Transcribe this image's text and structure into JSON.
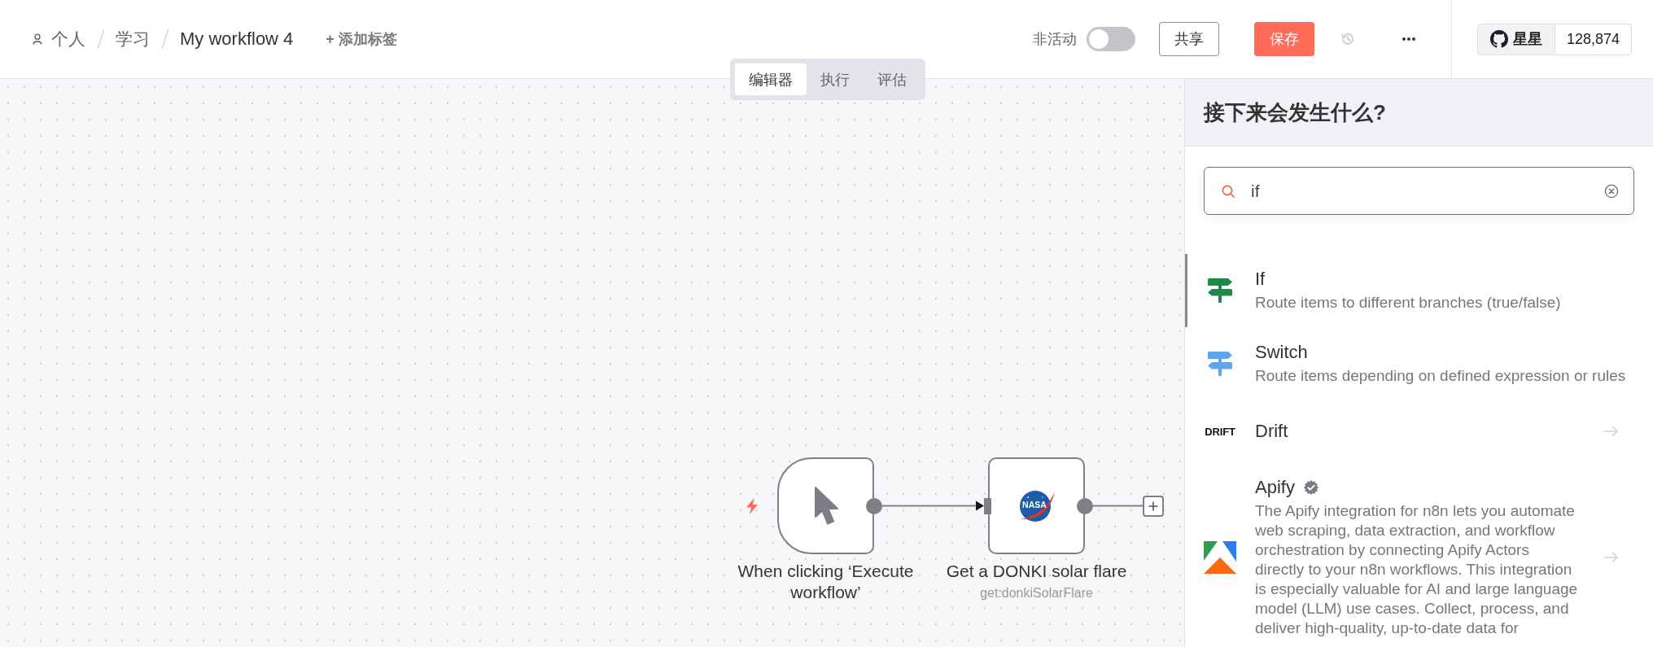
{
  "breadcrumb": {
    "owner": "个人",
    "folder": "学习",
    "workflow_name": "My workflow 4",
    "add_tag": "+ 添加标签"
  },
  "header": {
    "active_label": "非活动",
    "active": false,
    "share_button": "共享",
    "save_button": "保存",
    "github_star": {
      "label": "星星",
      "count": "128,874"
    }
  },
  "view_tabs": [
    {
      "label": "编辑器",
      "selected": true
    },
    {
      "label": "执行",
      "selected": false
    },
    {
      "label": "评估",
      "selected": false
    }
  ],
  "canvas": {
    "nodes": [
      {
        "kind": "trigger",
        "title": "When clicking ‘Execute workflow’",
        "output_connected": true
      },
      {
        "kind": "action",
        "logo_text": "NASA",
        "title": "Get a DONKI solar flare",
        "subtitle": "get:donkiSolarFlare",
        "output_connected": false
      }
    ]
  },
  "node_panel": {
    "title": "接下来会发生什么?",
    "search": {
      "value": "if"
    },
    "items": [
      {
        "kind": "if",
        "title": "If",
        "description": "Route items to different branches (true/false)",
        "selected": true,
        "has_actions": false,
        "verified": false
      },
      {
        "kind": "switch",
        "title": "Switch",
        "description": "Route items depending on defined expression or rules",
        "selected": false,
        "has_actions": false,
        "verified": false
      },
      {
        "kind": "drift",
        "logo_text": "DRIFT",
        "title": "Drift",
        "selected": false,
        "has_actions": true,
        "verified": false
      },
      {
        "kind": "apify",
        "title": "Apify",
        "description": "The Apify integration for n8n lets you automate web scraping, data extraction, and workflow orchestration by connecting Apify Actors directly to your n8n workflows. This integration is especially valuable for AI and large language model (LLM) use cases. Collect, process, and deliver high-quality, up-to-date data for",
        "selected": false,
        "has_actions": true,
        "verified": true
      }
    ]
  }
}
